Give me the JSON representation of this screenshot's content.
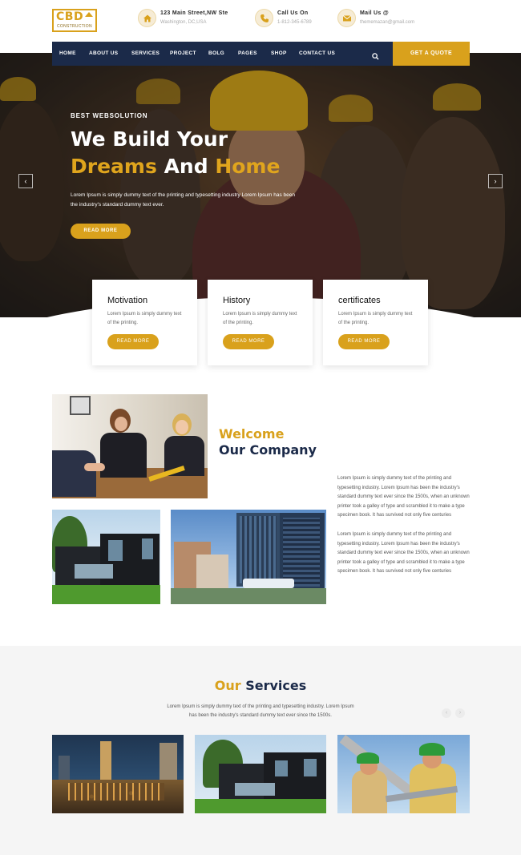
{
  "logo": {
    "text": "CBD",
    "sub": "CONSTRUCTION"
  },
  "contacts": [
    {
      "icon": "home-icon",
      "line1": "123 Main Street,NW Ste",
      "line2": "Washington, DC,USA"
    },
    {
      "icon": "phone-icon",
      "line1": "Call Us On",
      "line2": "1-812-345-6789"
    },
    {
      "icon": "mail-icon",
      "line1": "Mail Us @",
      "line2": "thememazan@gmail.com"
    }
  ],
  "nav": {
    "items": [
      "HOME",
      "ABOUT US",
      "SERVICES",
      "PROJECT",
      "BOLG",
      "PAGES",
      "SHOP",
      "CONTACT US"
    ],
    "search_icon": "search-icon",
    "cta": "GET A QUOTE"
  },
  "hero": {
    "kicker": "BEST WEBSOLUTION",
    "title_line1": "We Build Your",
    "title_line2_a": "Dreams",
    "title_line2_b": "And",
    "title_line2_c": "Home",
    "text": "Lorem Ipsum is simply dummy text of the printing and typesetting industry Lorem Ipsum has been the industry's standard dummy text ever.",
    "button": "READ MORE",
    "prev": "‹",
    "next": "›"
  },
  "cards": [
    {
      "title": "Motivation",
      "text": "Lorem Ipsum is simply dummy text of the printing.",
      "button": "READ MORE"
    },
    {
      "title": "History",
      "text": "Lorem Ipsum is simply dummy text of the printing.",
      "button": "READ MORE"
    },
    {
      "title": "certificates",
      "text": "Lorem Ipsum is simply dummy text of the printing.",
      "button": "READ MORE"
    }
  ],
  "welcome": {
    "title_a": "Welcome",
    "title_b": "Our Company",
    "p1": "Lorem Ipsum is simply dummy text of the printing and typesetting industry. Lorem Ipsum has been the industry's standard dummy text ever since the 1500s, when an unknown printer took a galley of type and scrambled it to make a type specimen book. It has survived not only five centuries",
    "p2": "Lorem Ipsum is simply dummy text of the printing and typesetting industry. Lorem Ipsum has been the industry's standard dummy text ever since the 1500s, when an unknown printer took a galley of type and scrambled it to make a type specimen book. It has survived not only five centuries"
  },
  "services": {
    "title_a": "Our",
    "title_b": "Services",
    "text": "Lorem Ipsum is simply dummy text of the printing and typesetting industry. Lorem Ipsum has been the industry's standard dummy text ever since the 1500s.",
    "prev": "‹",
    "next": "›"
  },
  "colors": {
    "accent": "#d9a11c",
    "navy": "#1b2a49"
  }
}
